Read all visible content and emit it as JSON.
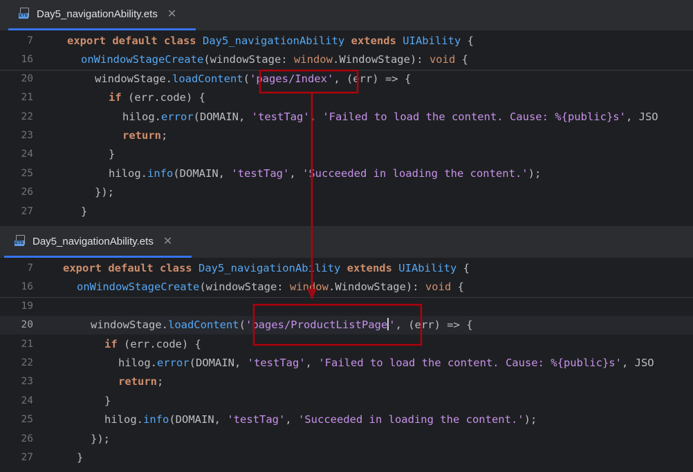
{
  "top": {
    "tab": {
      "filename": "Day5_navigationAbility.ets",
      "icon": "ets-file-icon",
      "close": "✕"
    },
    "lines": [
      {
        "n": "7",
        "parts": [
          [
            "kb",
            "export "
          ],
          [
            "kb",
            "default "
          ],
          [
            "kb",
            "class "
          ],
          [
            "fn",
            "Day5_navigationAbility"
          ],
          [
            "pa",
            " "
          ],
          [
            "kb",
            "extends "
          ],
          [
            "fn",
            "UIAbility"
          ],
          [
            "pa",
            " {"
          ]
        ]
      },
      {
        "n": "16",
        "parts": [
          [
            "fn",
            "onWindowStageCreate"
          ],
          [
            "pa",
            "(windowStage: "
          ],
          [
            "k",
            "window"
          ],
          [
            "pa",
            "."
          ],
          [
            "pa",
            "WindowStage"
          ],
          [
            "pa",
            "): "
          ],
          [
            "k",
            "void"
          ],
          [
            "pa",
            " {"
          ]
        ]
      },
      {
        "n": "20",
        "parts": [
          [
            "pa",
            "windowStage."
          ],
          [
            "fn",
            "loadContent"
          ],
          [
            "pa",
            "("
          ],
          [
            "strp",
            "'pages/Index'"
          ],
          [
            "pa",
            ", (err) => {"
          ]
        ]
      },
      {
        "n": "21",
        "parts": [
          [
            "kb",
            "if "
          ],
          [
            "pa",
            "(err.code) {"
          ]
        ]
      },
      {
        "n": "22",
        "parts": [
          [
            "pa",
            "hilog."
          ],
          [
            "fn",
            "error"
          ],
          [
            "pa",
            "(DOMAIN, "
          ],
          [
            "strp",
            "'testTag'"
          ],
          [
            "pa",
            ", "
          ],
          [
            "strp",
            "'Failed to load the content. Cause: %{public}s'"
          ],
          [
            "pa",
            ", JSO"
          ]
        ]
      },
      {
        "n": "23",
        "parts": [
          [
            "kb",
            "return"
          ],
          [
            "pa",
            ";"
          ]
        ]
      },
      {
        "n": "24",
        "parts": [
          [
            "pa",
            "}"
          ]
        ]
      },
      {
        "n": "25",
        "parts": [
          [
            "pa",
            "hilog."
          ],
          [
            "fn",
            "info"
          ],
          [
            "pa",
            "(DOMAIN, "
          ],
          [
            "strp",
            "'testTag'"
          ],
          [
            "pa",
            ", "
          ],
          [
            "strp",
            "'Succeeded in loading the content.'"
          ],
          [
            "pa",
            ");"
          ]
        ]
      },
      {
        "n": "26",
        "parts": [
          [
            "pa",
            "});"
          ]
        ]
      },
      {
        "n": "27",
        "parts": [
          [
            "pa",
            "}"
          ]
        ]
      }
    ]
  },
  "bottom": {
    "tab": {
      "filename": "Day5_navigationAbility.ets",
      "icon": "ets-file-icon",
      "close": "✕"
    },
    "lines": [
      {
        "n": "7",
        "parts": [
          [
            "kb",
            "export "
          ],
          [
            "kb",
            "default "
          ],
          [
            "kb",
            "class "
          ],
          [
            "fn",
            "Day5_navigationAbility"
          ],
          [
            "pa",
            " "
          ],
          [
            "kb",
            "extends "
          ],
          [
            "fn",
            "UIAbility"
          ],
          [
            "pa",
            " {"
          ]
        ]
      },
      {
        "n": "16",
        "parts": [
          [
            "fn",
            "onWindowStageCreate"
          ],
          [
            "pa",
            "(windowStage: "
          ],
          [
            "k",
            "window"
          ],
          [
            "pa",
            "."
          ],
          [
            "pa",
            "WindowStage"
          ],
          [
            "pa",
            "): "
          ],
          [
            "k",
            "void"
          ],
          [
            "pa",
            " {"
          ]
        ]
      },
      {
        "n": "19",
        "parts": []
      },
      {
        "n": "20",
        "parts": [
          [
            "pa",
            "windowStage."
          ],
          [
            "fn",
            "loadContent"
          ],
          [
            "pa",
            "("
          ],
          [
            "strp",
            "'pages/ProductListPage"
          ],
          [
            "cursor",
            ""
          ],
          [
            "strp",
            "'"
          ],
          [
            "pa",
            ", (err) => {"
          ]
        ]
      },
      {
        "n": "21",
        "parts": [
          [
            "kb",
            "if "
          ],
          [
            "pa",
            "(err.code) {"
          ]
        ]
      },
      {
        "n": "22",
        "parts": [
          [
            "pa",
            "hilog."
          ],
          [
            "fn",
            "error"
          ],
          [
            "pa",
            "(DOMAIN, "
          ],
          [
            "strp",
            "'testTag'"
          ],
          [
            "pa",
            ", "
          ],
          [
            "strp",
            "'Failed to load the content. Cause: %{public}s'"
          ],
          [
            "pa",
            ", JSO"
          ]
        ]
      },
      {
        "n": "23",
        "parts": [
          [
            "kb",
            "return"
          ],
          [
            "pa",
            ";"
          ]
        ]
      },
      {
        "n": "24",
        "parts": [
          [
            "pa",
            "}"
          ]
        ]
      },
      {
        "n": "25",
        "parts": [
          [
            "pa",
            "hilog."
          ],
          [
            "fn",
            "info"
          ],
          [
            "pa",
            "(DOMAIN, "
          ],
          [
            "strp",
            "'testTag'"
          ],
          [
            "pa",
            ", "
          ],
          [
            "strp",
            "'Succeeded in loading the content.'"
          ],
          [
            "pa",
            ");"
          ]
        ]
      },
      {
        "n": "26",
        "parts": [
          [
            "pa",
            "});"
          ]
        ]
      },
      {
        "n": "27",
        "parts": [
          [
            "pa",
            "}"
          ]
        ]
      }
    ]
  },
  "colors": {
    "annotation": "#b2000c",
    "tab_accent": "#3574f0",
    "background": "#1e1f22"
  }
}
